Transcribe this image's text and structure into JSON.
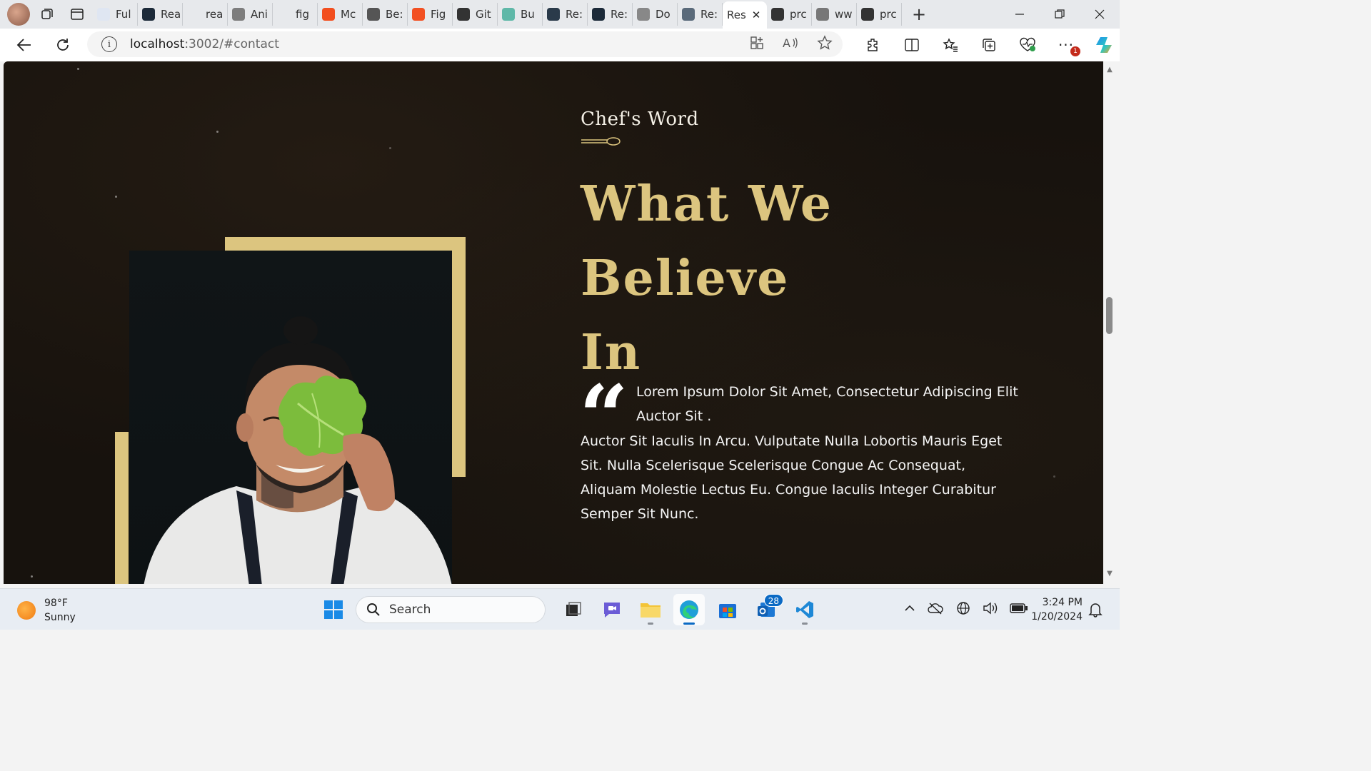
{
  "browser": {
    "tabs": [
      {
        "label": "Ful",
        "fav_color": "#dfe6f2",
        "icon": "document-icon"
      },
      {
        "label": "Rea",
        "fav_color": "#1c2a39",
        "icon": "react-icon"
      },
      {
        "label": "rea",
        "fav_color": "#e7e9ec",
        "icon": "search-icon"
      },
      {
        "label": "Ani",
        "fav_color": "#7d7d7d",
        "icon": "a-icon"
      },
      {
        "label": "fig",
        "fav_color": "#e7e9ec",
        "icon": "search-icon"
      },
      {
        "label": "Mc",
        "fav_color": "#f24e1e",
        "icon": "figma-icon"
      },
      {
        "label": "Be:",
        "fav_color": "#555555",
        "icon": "circle-icon"
      },
      {
        "label": "Fig",
        "fav_color": "#f25022",
        "icon": "microsoft-icon"
      },
      {
        "label": "Git",
        "fav_color": "#333333",
        "icon": "github-icon"
      },
      {
        "label": "Bu",
        "fav_color": "#5fb8a8",
        "icon": "diamond-icon"
      },
      {
        "label": "Re:",
        "fav_color": "#2a3a4a",
        "icon": "react-icon"
      },
      {
        "label": "Re:",
        "fav_color": "#1c2a39",
        "icon": "react-icon"
      },
      {
        "label": "Do",
        "fav_color": "#888888",
        "icon": "shield-icon"
      },
      {
        "label": "Re:",
        "fav_color": "#5a6a7a",
        "icon": "react-icon"
      }
    ],
    "active_tab": {
      "label": "Res",
      "close": "✕"
    },
    "tabs_after": [
      {
        "label": "prc",
        "fav_color": "#333333",
        "icon": "github-icon"
      },
      {
        "label": "ww",
        "fav_color": "#777777",
        "icon": "page-icon"
      },
      {
        "label": "prc",
        "fav_color": "#333333",
        "icon": "github-icon"
      }
    ],
    "url_host": "localhost",
    "url_rest": ":3002/#contact",
    "notification_count": "1"
  },
  "page": {
    "eyebrow": "Chef's Word",
    "headline_line1": "What We Believe",
    "headline_line2": "In",
    "quote_mark": "“",
    "quote_first": "Lorem Ipsum Dolor Sit Amet, Consectetur Adipiscing Elit Auctor Sit .",
    "quote_rest": "Auctor Sit Iaculis In Arcu. Vulputate Nulla Lobortis Mauris Eget Sit. Nulla Scelerisque Scelerisque Congue Ac Consequat, Aliquam Molestie Lectus Eu. Congue Iaculis Integer Curabitur Semper Sit Nunc.",
    "accent_color": "#dcc57f"
  },
  "taskbar": {
    "weather_temp": "98°F",
    "weather_desc": "Sunny",
    "search_label": "Search",
    "store_badge": "28",
    "time": "3:24 PM",
    "date": "1/20/2024"
  }
}
